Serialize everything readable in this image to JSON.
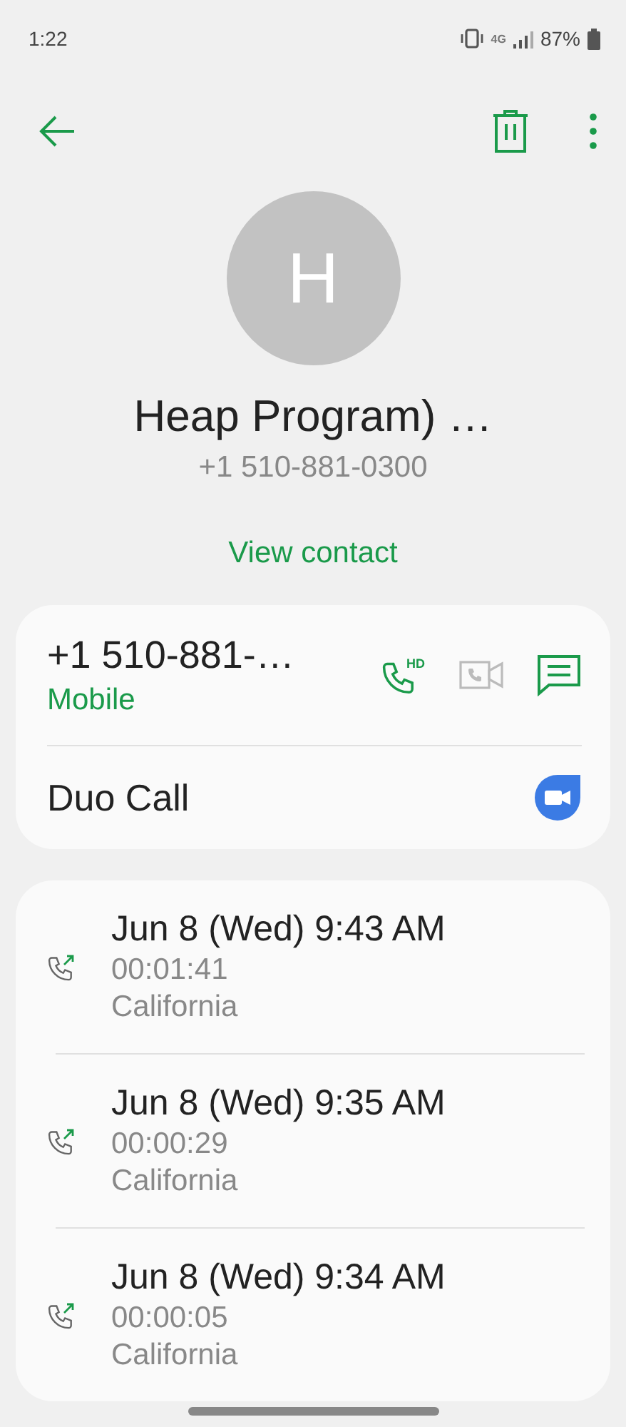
{
  "status_bar": {
    "time": "1:22",
    "network": "4G",
    "battery": "87%"
  },
  "contact": {
    "initial": "H",
    "name": "Heap Program) …",
    "number": "+1 510-881-0300",
    "link": "View contact"
  },
  "phone_card": {
    "number": "+1 510-881-…",
    "label": "Mobile",
    "actions": [
      {
        "kind": "hd_call",
        "enabled": true,
        "badge": "HD"
      },
      {
        "kind": "video",
        "enabled": false
      },
      {
        "kind": "message",
        "enabled": true
      }
    ],
    "duo": "Duo Call"
  },
  "calls": [
    {
      "kind": "outgoing",
      "time": "Jun 8 (Wed) 9:43 AM",
      "duration": "00:01:41",
      "location": "California"
    },
    {
      "kind": "outgoing",
      "time": "Jun 8 (Wed) 9:35 AM",
      "duration": "00:00:29",
      "location": "California"
    },
    {
      "kind": "outgoing",
      "time": "Jun 8 (Wed) 9:34 AM",
      "duration": "00:00:05",
      "location": "California"
    }
  ]
}
